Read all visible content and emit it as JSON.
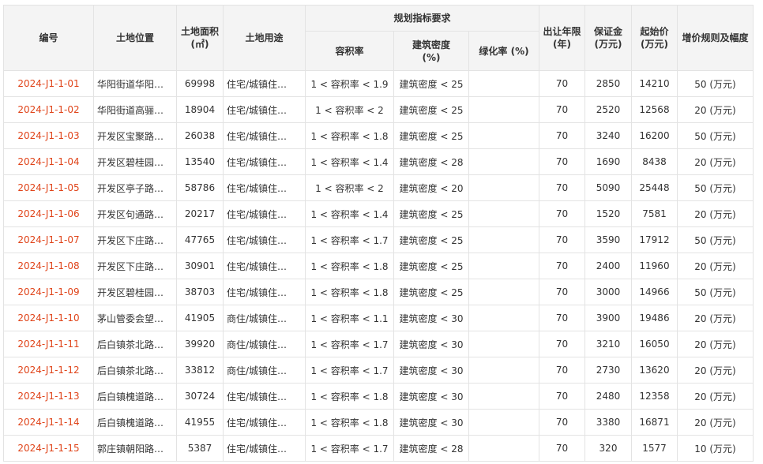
{
  "headers": {
    "code": "编号",
    "location": "土地位置",
    "area_line1": "土地面积",
    "area_line2": "(㎡)",
    "use": "土地用途",
    "planning_group": "规划指标要求",
    "far": "容积率",
    "density_line1": "建筑密度",
    "density_line2": "(%)",
    "green": "绿化率 (%)",
    "years_line1": "出让年限",
    "years_line2": "(年)",
    "deposit_line1": "保证金",
    "deposit_line2": "(万元)",
    "start_line1": "起始价",
    "start_line2": "(万元)",
    "increment": "增价规则及幅度"
  },
  "rows": [
    {
      "code": "2024-J1-1-01",
      "location": "华阳街道华阳…",
      "area": "69998",
      "use": "住宅/城镇住…",
      "far": "1 < 容积率 < 1.9",
      "density": "建筑密度 < 25",
      "green": "",
      "years": "70",
      "deposit": "2850",
      "start": "14210",
      "increment": "50 (万元)"
    },
    {
      "code": "2024-J1-1-02",
      "location": "华阳街道高骊…",
      "area": "18904",
      "use": "住宅/城镇住…",
      "far": "1 < 容积率 < 2",
      "density": "建筑密度 < 25",
      "green": "",
      "years": "70",
      "deposit": "2520",
      "start": "12568",
      "increment": "20 (万元)"
    },
    {
      "code": "2024-J1-1-03",
      "location": "开发区宝聚路…",
      "area": "26038",
      "use": "住宅/城镇住…",
      "far": "1 < 容积率 < 1.8",
      "density": "建筑密度 < 25",
      "green": "",
      "years": "70",
      "deposit": "3240",
      "start": "16200",
      "increment": "50 (万元)"
    },
    {
      "code": "2024-J1-1-04",
      "location": "开发区碧桂园…",
      "area": "13540",
      "use": "住宅/城镇住…",
      "far": "1 < 容积率 < 1.4",
      "density": "建筑密度 < 28",
      "green": "",
      "years": "70",
      "deposit": "1690",
      "start": "8438",
      "increment": "20 (万元)"
    },
    {
      "code": "2024-J1-1-05",
      "location": "开发区亭子路…",
      "area": "58786",
      "use": "住宅/城镇住…",
      "far": "1 < 容积率 < 2",
      "density": "建筑密度 < 20",
      "green": "",
      "years": "70",
      "deposit": "5090",
      "start": "25448",
      "increment": "50 (万元)"
    },
    {
      "code": "2024-J1-1-06",
      "location": "开发区句通路…",
      "area": "20217",
      "use": "住宅/城镇住…",
      "far": "1 < 容积率 < 1.4",
      "density": "建筑密度 < 25",
      "green": "",
      "years": "70",
      "deposit": "1520",
      "start": "7581",
      "increment": "20 (万元)"
    },
    {
      "code": "2024-J1-1-07",
      "location": "开发区下庄路…",
      "area": "47765",
      "use": "住宅/城镇住…",
      "far": "1 < 容积率 < 1.7",
      "density": "建筑密度 < 25",
      "green": "",
      "years": "70",
      "deposit": "3590",
      "start": "17912",
      "increment": "50 (万元)"
    },
    {
      "code": "2024-J1-1-08",
      "location": "开发区下庄路…",
      "area": "30901",
      "use": "住宅/城镇住…",
      "far": "1 < 容积率 < 1.8",
      "density": "建筑密度 < 25",
      "green": "",
      "years": "70",
      "deposit": "2400",
      "start": "11960",
      "increment": "20 (万元)"
    },
    {
      "code": "2024-J1-1-09",
      "location": "开发区碧桂园…",
      "area": "38703",
      "use": "住宅/城镇住…",
      "far": "1 < 容积率 < 1.8",
      "density": "建筑密度 < 25",
      "green": "",
      "years": "70",
      "deposit": "3000",
      "start": "14966",
      "increment": "50 (万元)"
    },
    {
      "code": "2024-J1-1-10",
      "location": "茅山管委会望…",
      "area": "41905",
      "use": "商住/城镇住…",
      "far": "1 < 容积率 < 1.1",
      "density": "建筑密度 < 30",
      "green": "",
      "years": "70",
      "deposit": "3900",
      "start": "19486",
      "increment": "20 (万元)"
    },
    {
      "code": "2024-J1-1-11",
      "location": "后白镇茶北路…",
      "area": "39920",
      "use": "商住/城镇住…",
      "far": "1 < 容积率 < 1.7",
      "density": "建筑密度 < 30",
      "green": "",
      "years": "70",
      "deposit": "3210",
      "start": "16050",
      "increment": "20 (万元)"
    },
    {
      "code": "2024-J1-1-12",
      "location": "后白镇茶北路…",
      "area": "33812",
      "use": "商住/城镇住…",
      "far": "1 < 容积率 < 1.7",
      "density": "建筑密度 < 30",
      "green": "",
      "years": "70",
      "deposit": "2730",
      "start": "13620",
      "increment": "20 (万元)"
    },
    {
      "code": "2024-J1-1-13",
      "location": "后白镇槐道路…",
      "area": "30724",
      "use": "住宅/城镇住…",
      "far": "1 < 容积率 < 1.8",
      "density": "建筑密度 < 30",
      "green": "",
      "years": "70",
      "deposit": "2480",
      "start": "12358",
      "increment": "20 (万元)"
    },
    {
      "code": "2024-J1-1-14",
      "location": "后白镇槐道路…",
      "area": "41955",
      "use": "住宅/城镇住…",
      "far": "1 < 容积率 < 1.8",
      "density": "建筑密度 < 30",
      "green": "",
      "years": "70",
      "deposit": "3380",
      "start": "16871",
      "increment": "20 (万元)"
    },
    {
      "code": "2024-J1-1-15",
      "location": "郭庄镇朝阳路…",
      "area": "5387",
      "use": "住宅/城镇住…",
      "far": "1 < 容积率 < 1.7",
      "density": "建筑密度 < 28",
      "green": "",
      "years": "70",
      "deposit": "320",
      "start": "1577",
      "increment": "10 (万元)"
    }
  ]
}
